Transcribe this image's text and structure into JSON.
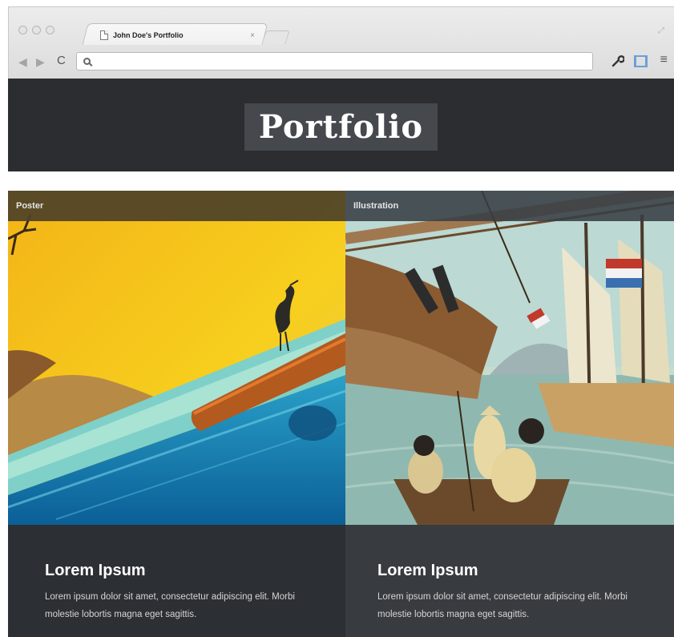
{
  "browser": {
    "tab_title": "John Doe's Portfolio",
    "tab_close": "×",
    "address_value": "",
    "nav_back": "◀",
    "nav_forward": "▶",
    "nav_reload": "C",
    "menu_icon": "≡",
    "wrench_icon": "🔧",
    "resize_icon": "⤢"
  },
  "header": {
    "logo_text": "Portfolio"
  },
  "cards": [
    {
      "category": "Poster",
      "title": "Lorem Ipsum",
      "text": "Lorem ipsum dolor sit amet, consectetur adipiscing elit. Morbi molestie lobortis magna eget sagittis."
    },
    {
      "category": "Illustration",
      "title": "Lorem Ipsum",
      "text": "Lorem ipsum dolor sit amet, consectetur adipiscing elit. Morbi molestie lobortis magna eget sagittis."
    }
  ],
  "colors": {
    "header_bg": "#2b2d31",
    "logo_bg": "#45484d",
    "card_body_left": "#2c2f33",
    "card_body_right": "#383b3f"
  }
}
